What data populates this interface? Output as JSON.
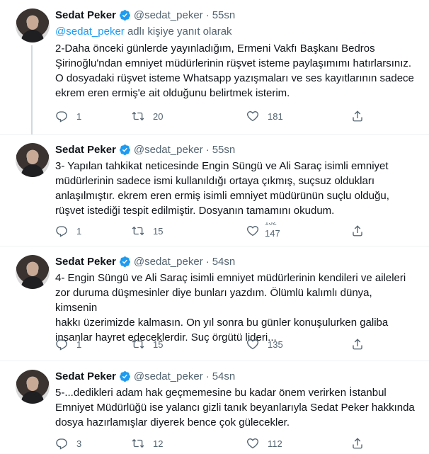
{
  "tweets": [
    {
      "author_name": "Sedat Peker",
      "author_handle": "@sedat_peker",
      "time": "55sn",
      "reply_mention": "@sedat_peker",
      "reply_suffix": " adlı kişiye yanıt olarak",
      "text": "2-Daha önceki günlerde yayınladığım, Ermeni Vakfı Başkanı Bedros\nŞirinoğlu'ndan emniyet müdürlerinin rüşvet isteme paylaşımımı hatırlarsınız.\nO dosyadaki rüşvet isteme Whatsapp yazışmaları ve ses kayıtlarının sadece\nekrem eren ermiş'e ait olduğunu belirtmek isterim.",
      "replies": "1",
      "retweets": "20",
      "likes": "181"
    },
    {
      "author_name": "Sedat Peker",
      "author_handle": "@sedat_peker",
      "time": "55sn",
      "text": "3- Yapılan tahkikat neticesinde Engin Süngü ve Ali Saraç isimli emniyet\nmüdürlerinin sadece ismi kullanıldığı ortaya çıkmış, suçsuz oldukları\nanlaşılmıştır. ekrem eren ermiş isimli emniyet müdürünün suçlu olduğu,\nrüşvet istediği tespit edilmiştir. Dosyanın tamamını okudum.",
      "replies": "1",
      "retweets": "15",
      "likes_partial": "132",
      "likes": "147"
    },
    {
      "author_name": "Sedat Peker",
      "author_handle": "@sedat_peker",
      "time": "54sn",
      "text": "4- Engin Süngü ve Ali Saraç isimli emniyet müdürlerinin kendileri ve aileleri\nzor duruma düşmesinler diye bunları yazdım. Ölümlü kalımlı dünya, kimsenin\nhakkı üzerimizde kalmasın. On yıl sonra bu günler konuşulurken galiba\ninsanlar hayret edeceklerdir. Suç örgütü lideri...",
      "replies": "1",
      "retweets": "15",
      "likes": "135"
    },
    {
      "author_name": "Sedat Peker",
      "author_handle": "@sedat_peker",
      "time": "54sn",
      "text": "5-...dedikleri adam hak geçmemesine bu kadar önem verirken İstanbul\nEmniyet Müdürlüğü ise yalancı gizli tanık beyanlarıyla Sedat Peker hakkında\ndosya hazırlamışlar diyerek bence çok gülecekler.",
      "replies": "3",
      "retweets": "12",
      "likes": "112"
    }
  ],
  "colors": {
    "accent": "#1d9bf0",
    "muted": "#536471",
    "text": "#0f1419",
    "thread_line": "#cfd9de",
    "divider": "#eff3f4"
  },
  "icons": [
    "reply-icon",
    "retweet-icon",
    "like-icon",
    "share-icon",
    "verified-badge-icon"
  ]
}
